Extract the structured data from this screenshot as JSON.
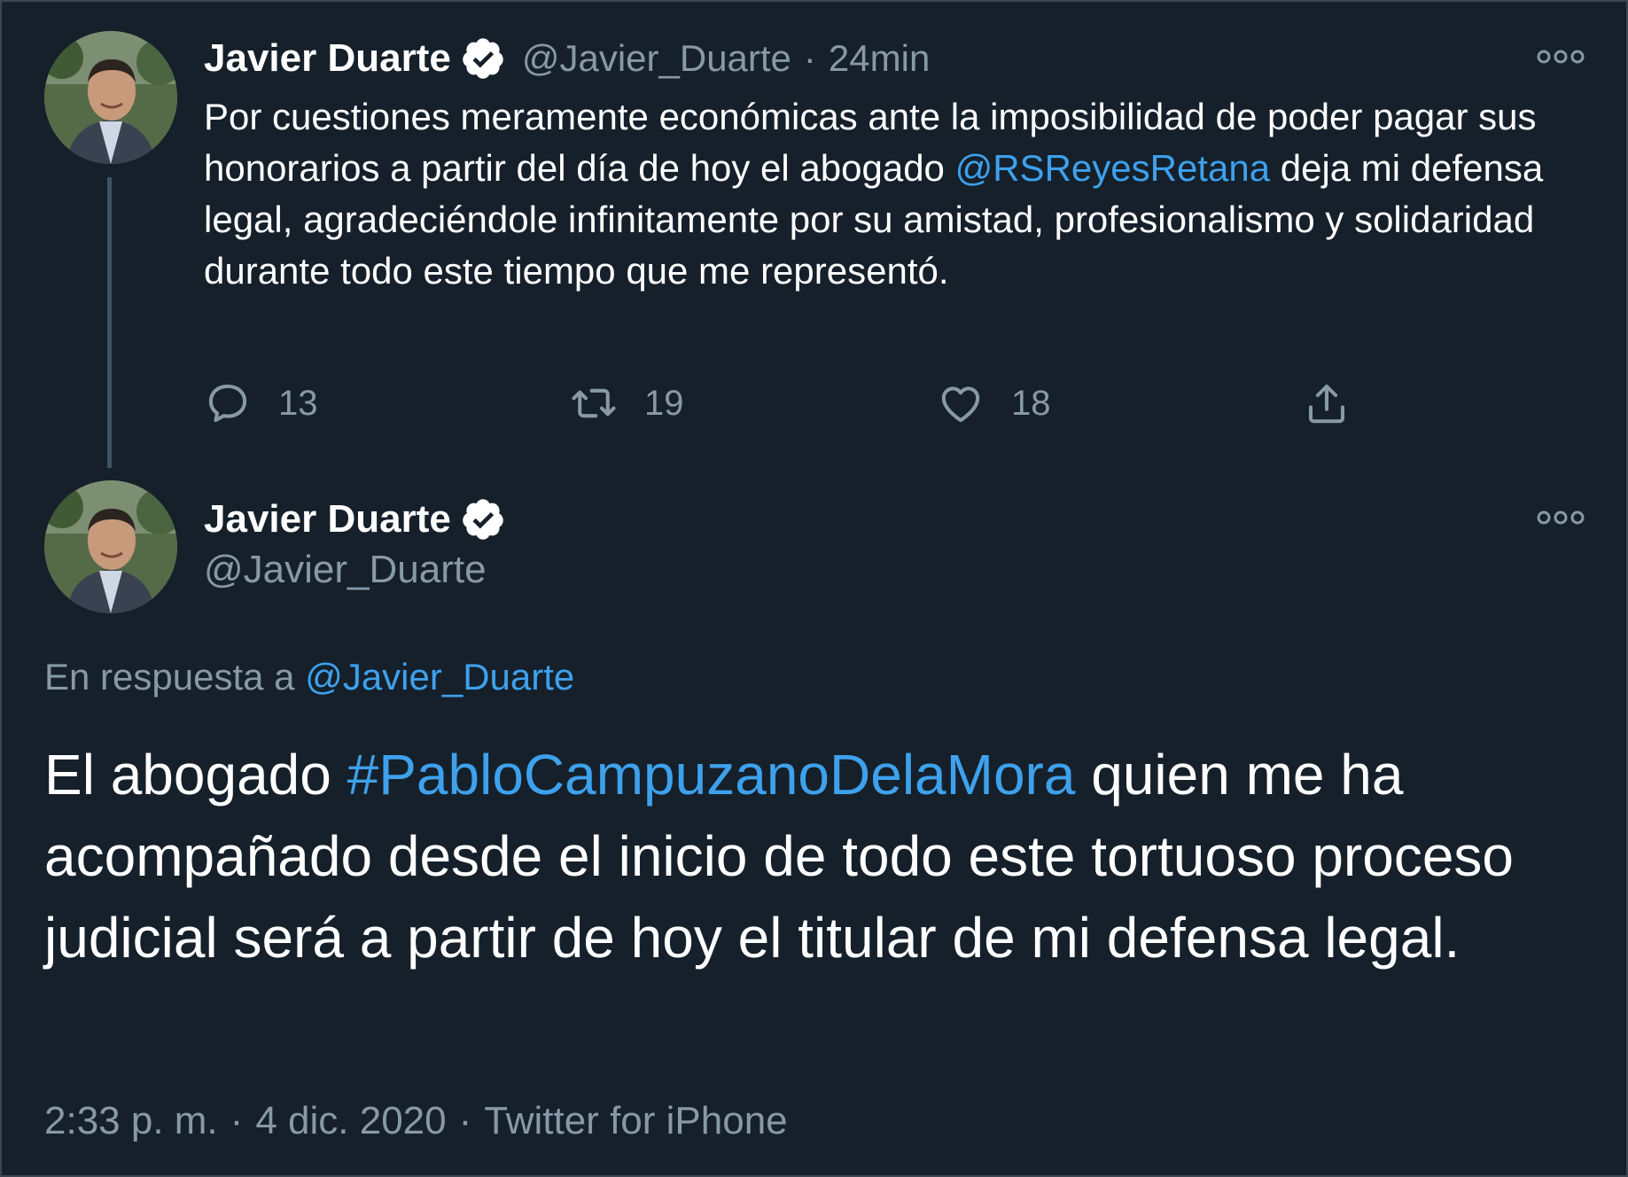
{
  "tweet1": {
    "display_name": "Javier Duarte",
    "handle": "@Javier_Duarte",
    "separator": "·",
    "time": "24min",
    "text_part1": "Por cuestiones meramente económicas ante la imposibilidad de poder pagar sus honorarios a partir del día de hoy el abogado ",
    "mention": "@RSReyesRetana",
    "text_part2": " deja mi defensa legal, agradeciéndole infinitamente por su amistad, profesionalismo y solidaridad durante todo este tiempo que me representó.",
    "reply_count": "13",
    "retweet_count": "19",
    "like_count": "18"
  },
  "tweet2": {
    "display_name": "Javier Duarte",
    "handle": "@Javier_Duarte",
    "reply_prefix": "En respuesta a ",
    "reply_handle": "@Javier_Duarte",
    "text_part1": "El abogado ",
    "hashtag": "#PabloCampuzanoDelaMora",
    "text_part2": " quien me ha acompañado desde el inicio de todo este tortuoso proceso judicial será a partir de hoy el titular de mi defensa legal.",
    "time": "2:33 p. m.",
    "date": "4 dic. 2020",
    "source": "Twitter for iPhone",
    "meta_separator": "·"
  },
  "icons": {
    "verified": "verified-badge-icon",
    "more": "more-options-icon",
    "reply": "reply-icon",
    "retweet": "retweet-icon",
    "like": "like-icon",
    "share": "share-icon"
  },
  "colors": {
    "background": "#15202b",
    "link": "#3ea1ec",
    "secondary_text": "#8899a6"
  }
}
